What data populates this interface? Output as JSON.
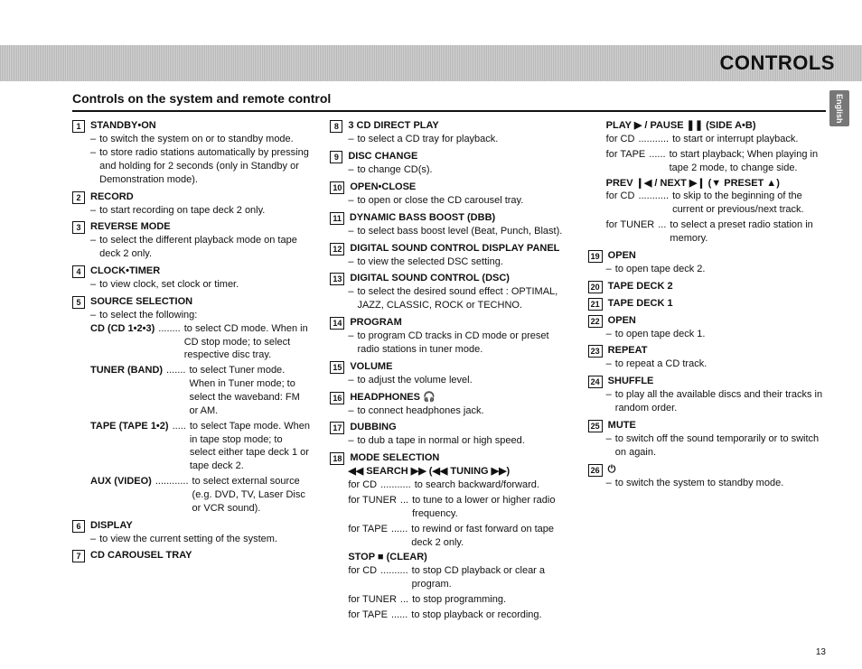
{
  "banner": "CONTROLS",
  "langTab": "English",
  "pageNumber": "13",
  "sectionTitle": "Controls on the system and remote control",
  "entries": [
    {
      "num": "1",
      "title": "STANDBY•ON",
      "subs": [
        "to switch the system on or to standby mode.",
        "to store radio stations automatically by pressing and holding for 2 seconds (only in Standby or Demonstration mode)."
      ]
    },
    {
      "num": "2",
      "title": "RECORD",
      "subs": [
        "to start recording on tape deck 2 only."
      ]
    },
    {
      "num": "3",
      "title": "REVERSE MODE",
      "subs": [
        "to select the different playback mode on tape deck 2 only."
      ]
    },
    {
      "num": "4",
      "title": "CLOCK•TIMER",
      "subs": [
        "to view clock, set clock or timer."
      ]
    },
    {
      "num": "5",
      "title": "SOURCE SELECTION",
      "subs": [
        "to select the following:"
      ],
      "kv": [
        {
          "key": "CD (CD 1•2•3)",
          "dots": "........",
          "val": "to select CD mode.  When in CD stop mode; to select respective disc tray."
        },
        {
          "key": "TUNER (BAND)",
          "dots": ".......",
          "val": "to select Tuner mode.  When in Tuner mode; to select the waveband:  FM or AM."
        },
        {
          "key": "TAPE (TAPE 1•2)",
          "dots": ".....",
          "val": "to select Tape mode.  When in tape stop mode; to select either tape deck 1 or tape deck 2."
        },
        {
          "key": "AUX (VIDEO)",
          "dots": "............",
          "val": "to select external source (e.g. DVD, TV, Laser Disc or VCR sound)."
        }
      ]
    },
    {
      "num": "6",
      "title": "DISPLAY",
      "subs": [
        "to view the current setting of the system."
      ]
    },
    {
      "num": "7",
      "title": "CD CAROUSEL TRAY"
    },
    {
      "num": "8",
      "title": "3 CD DIRECT PLAY",
      "subs": [
        "to select a CD tray for playback."
      ],
      "colbreak": true
    },
    {
      "num": "9",
      "title": "DISC CHANGE",
      "subs": [
        "to change CD(s)."
      ]
    },
    {
      "num": "10",
      "title": "OPEN•CLOSE",
      "subs": [
        "to open or close the CD carousel tray."
      ]
    },
    {
      "num": "11",
      "title": "DYNAMIC BASS BOOST (DBB)",
      "subs": [
        "to select bass boost level (Beat, Punch, Blast)."
      ]
    },
    {
      "num": "12",
      "title": "DIGITAL SOUND CONTROL DISPLAY PANEL",
      "subs": [
        "to view the selected DSC setting."
      ]
    },
    {
      "num": "13",
      "title": "DIGITAL SOUND CONTROL (DSC)",
      "subs": [
        "to select the desired sound effect : OPTIMAL, JAZZ, CLASSIC, ROCK or TECHNO."
      ]
    },
    {
      "num": "14",
      "title": "PROGRAM",
      "subs": [
        "to program CD tracks in CD mode or preset radio stations in tuner mode."
      ]
    },
    {
      "num": "15",
      "title": "VOLUME",
      "subs": [
        "to adjust the volume level."
      ]
    },
    {
      "num": "16",
      "title": "HEADPHONES  🎧",
      "subs": [
        "to connect headphones jack."
      ]
    },
    {
      "num": "17",
      "title": "DUBBING",
      "subs": [
        "to dub a tape in normal or high speed."
      ]
    },
    {
      "num": "18",
      "title": "MODE SELECTION",
      "extras": [
        {
          "bold": "◀◀ SEARCH ▶▶  (◀◀ TUNING ▶▶)"
        }
      ],
      "kvPlain": [
        {
          "key": "for CD",
          "dots": "...........",
          "val": "to search backward/forward."
        },
        {
          "key": "for TUNER",
          "dots": "...",
          "val": "to tune to a lower or higher radio frequency."
        },
        {
          "key": "for TAPE",
          "dots": "......",
          "val": "to rewind or fast forward on tape deck 2 only."
        }
      ],
      "extras2": [
        {
          "bold": "STOP ■  (CLEAR)"
        }
      ],
      "kvPlain2": [
        {
          "key": "for CD",
          "dots": "..........",
          "val": "to stop CD playback or clear a program."
        },
        {
          "key": "for TUNER",
          "dots": "...",
          "val": "to stop programming."
        },
        {
          "key": "for TAPE",
          "dots": "......",
          "val": "to stop playback or recording."
        }
      ]
    },
    {
      "colbreak": true,
      "extraHead": "PLAY ▶  / PAUSE ❚❚  (SIDE A•B)",
      "kvPlain": [
        {
          "key": "for CD",
          "dots": "...........",
          "val": "to start or interrupt playback."
        },
        {
          "key": "for TAPE",
          "dots": "......",
          "val": "to start playback; When playing in tape 2 mode, to change side."
        }
      ],
      "extras2": [
        {
          "bold": "PREV ❙◀  / NEXT ▶❙  (▼ PRESET ▲)"
        }
      ],
      "kvPlain2": [
        {
          "key": "for CD",
          "dots": "...........",
          "val": "to skip to the beginning of the current or previous/next track."
        },
        {
          "key": "for TUNER",
          "dots": "...",
          "val": "to select a preset radio station in memory."
        }
      ]
    },
    {
      "num": "19",
      "title": "OPEN",
      "subs": [
        "to open tape deck 2."
      ]
    },
    {
      "num": "20",
      "title": "TAPE DECK 2"
    },
    {
      "num": "21",
      "title": "TAPE DECK 1"
    },
    {
      "num": "22",
      "title": "OPEN",
      "subs": [
        "to open tape deck 1."
      ]
    },
    {
      "num": "23",
      "title": "REPEAT",
      "subs": [
        "to repeat a CD track."
      ]
    },
    {
      "num": "24",
      "title": "SHUFFLE",
      "subs": [
        "to play all the available discs and their tracks in random order."
      ]
    },
    {
      "num": "25",
      "title": "MUTE",
      "subs": [
        "to switch off the sound temporarily or to switch on again."
      ]
    },
    {
      "num": "26",
      "title": "⏻",
      "subs": [
        "to switch the system to standby mode."
      ]
    }
  ]
}
